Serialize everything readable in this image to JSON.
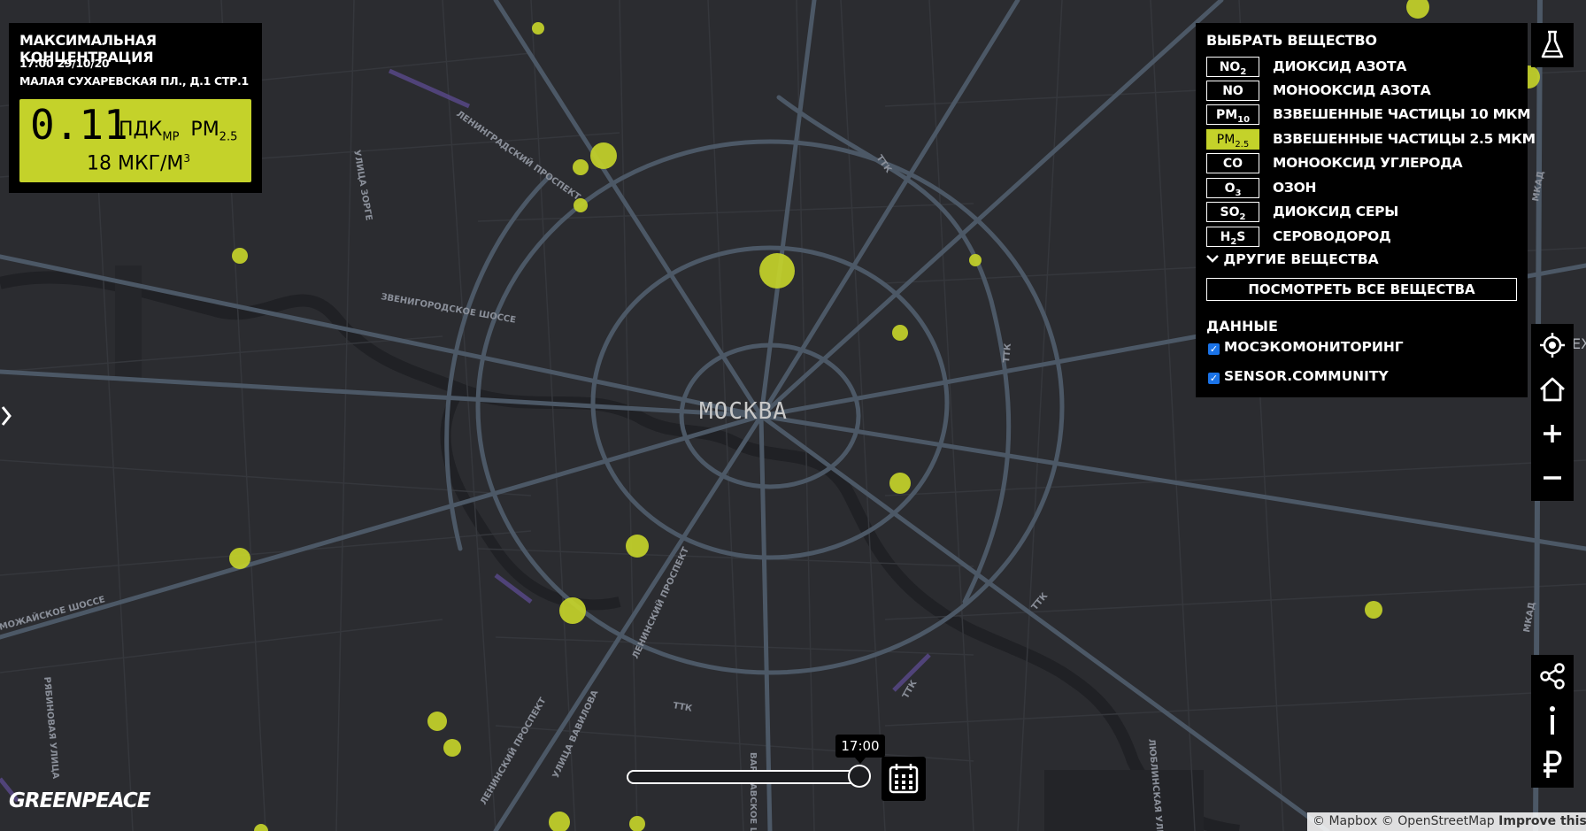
{
  "colors": {
    "accent": "#c4d22a",
    "map_bg": "#2b2c30",
    "roads": "#4c5866",
    "panel": "#000000"
  },
  "max_panel": {
    "title": "МАКСИМАЛЬНАЯ КОНЦЕНТРАЦИЯ",
    "datetime": "17:00 29/10/20",
    "address": "МАЛАЯ СУХАРЕВСКАЯ ПЛ., Д.1 СТР.1",
    "value": "0.11",
    "unit_pdk": "ПДК",
    "unit_pdk_sub": "МР",
    "pollutant": "PM",
    "pollutant_sub": "2.5",
    "concentration": "18 МКГ/М",
    "concentration_sup": "3"
  },
  "substances": {
    "title": "ВЫБРАТЬ ВЕЩЕСТВО",
    "items": [
      {
        "code": "NO",
        "sub": "2",
        "name": "ДИОКСИД АЗОТА",
        "active": false
      },
      {
        "code": "NO",
        "sub": "",
        "name": "МОНООКСИД АЗОТА",
        "active": false
      },
      {
        "code": "PM",
        "sub": "10",
        "name": "ВЗВЕШЕННЫЕ ЧАСТИЦЫ 10 МКМ",
        "active": false
      },
      {
        "code": "PM",
        "sub": "2.5",
        "name": "ВЗВЕШЕННЫЕ ЧАСТИЦЫ 2.5 МКМ",
        "active": true
      },
      {
        "code": "CO",
        "sub": "",
        "name": "МОНООКСИД УГЛЕРОДА",
        "active": false
      },
      {
        "code": "O",
        "sub": "3",
        "name": "ОЗОН",
        "active": false
      },
      {
        "code": "SO",
        "sub": "2",
        "name": "ДИОКСИД СЕРЫ",
        "active": false
      },
      {
        "code": "H",
        "sub": "2",
        "code2": "S",
        "name": "СЕРОВОДОРОД",
        "active": false
      }
    ],
    "other_label": "ДРУГИЕ ВЕЩЕСТВА",
    "view_all_label": "ПОСМОТРЕТЬ ВСЕ ВЕЩЕСТВА",
    "data_label": "ДАННЫЕ",
    "sources": [
      {
        "label": "МОСЭКОМОНИТОРИНГ",
        "checked": true
      },
      {
        "label": "SENSOR.COMMUNITY",
        "checked": true
      }
    ]
  },
  "map": {
    "city_label": "МОСКВА",
    "road_labels": [
      "ЛЕНИНГРАДСКИЙ ПРОСПЕКТ",
      "УЛИЦА ЗОРГЕ",
      "ЗВЕНИГОРОДСКОЕ ШОССЕ",
      "ТТК",
      "МКАД",
      "ЛЕНИНСКИЙ ПРОСПЕКТ",
      "УЛИЦА ВАВИЛОВА",
      "ВАРШАВСКОЕ ШОССЕ",
      "ЛЮБЛИНСКАЯ УЛИЦА",
      "РЯБИНОВАЯ УЛИЦА",
      "МОЖАЙСКОЕ ШОССЕ"
    ],
    "edge_text": "EX",
    "stations": [
      {
        "value": 18,
        "lat_rank": 1
      }
    ]
  },
  "timeline": {
    "time": "17:00",
    "position": 1.0
  },
  "logo": "GREENPEACE",
  "attribution": {
    "mapbox": "© Mapbox",
    "osm": "© OpenStreetMap",
    "improve": "Improve this m"
  },
  "icons": [
    "flask-icon",
    "locate-icon",
    "home-icon",
    "zoom-in-icon",
    "zoom-out-icon",
    "share-icon",
    "info-icon",
    "ruble-icon",
    "calendar-icon",
    "arrow-right-icon",
    "chevron-down-icon"
  ]
}
